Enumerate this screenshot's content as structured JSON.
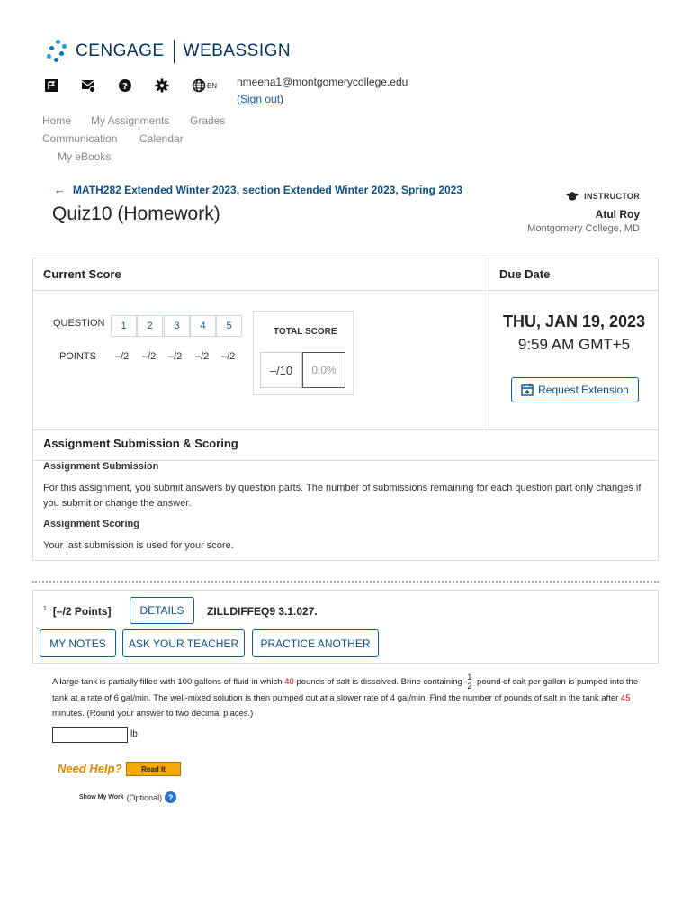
{
  "brand": {
    "name_left": "CENGAGE",
    "name_right": "WEBASSIGN"
  },
  "header": {
    "lang": "EN",
    "email": "nmeena1@montgomerycollege.edu",
    "signout_prefix": "(",
    "signout": "Sign out",
    "signout_suffix": ")"
  },
  "nav": {
    "home": "Home",
    "assignments": "My Assignments",
    "grades": "Grades",
    "communication": "Communication",
    "calendar": "Calendar",
    "ebooks": "My eBooks"
  },
  "breadcrumb": "MATH282 Extended Winter 2023, section Extended Winter 2023, Spring 2023",
  "page_title": "Quiz10 (Homework)",
  "instructor": {
    "label": "INSTRUCTOR",
    "name": "Atul Roy",
    "school": "Montgomery College, MD"
  },
  "score": {
    "header": "Current Score",
    "question_label": "QUESTION",
    "points_label": "POINTS",
    "questions": [
      "1",
      "2",
      "3",
      "4",
      "5"
    ],
    "points": [
      "–/2",
      "–/2",
      "–/2",
      "–/2",
      "–/2"
    ],
    "total_label": "TOTAL SCORE",
    "total": "–/10",
    "percent": "0.0%"
  },
  "due": {
    "header": "Due Date",
    "day": "THU, JAN 19, 2023",
    "time": "9:59 AM GMT+5",
    "request": "Request Extension"
  },
  "submission": {
    "header": "Assignment Submission & Scoring",
    "sub_title": "Assignment Submission",
    "sub_text": "For this assignment, you submit answers by question parts. The number of submissions remaining for each question part only changes if you submit or change the answer.",
    "score_title": "Assignment Scoring",
    "score_text": "Your last submission is used for your score."
  },
  "question": {
    "number": "1.",
    "points": "[–/2 Points]",
    "details": "DETAILS",
    "code": "ZILLDIFFEQ9 3.1.027.",
    "my_notes": "MY NOTES",
    "ask": "ASK YOUR TEACHER",
    "practice": "PRACTICE ANOTHER",
    "p1": "A large tank is partially filled with 100 gallons of fluid in which ",
    "salt": "40",
    "p2": " pounds of salt is dissolved. Brine containing ",
    "frac_n": "1",
    "frac_d": "2",
    "p3": " pound of salt per gallon is pumped into the tank at a rate of 6 gal/min. The well-mixed solution is then pumped out at a slower rate of 4 gal/min. Find the number of pounds of salt in the tank after ",
    "minutes": "45",
    "p4": " minutes. (Round your answer to two decimal places.)",
    "answer_value": "",
    "unit": "lb",
    "need_help": "Need Help?",
    "read_it": "Read It",
    "show_work": "Show My Work",
    "optional": "(Optional)",
    "help_icon_text": "?"
  },
  "colors": {
    "brand": "#00305e",
    "link": "#0b5ea8",
    "highlight": "#dd0000",
    "help": "#e08a00"
  }
}
